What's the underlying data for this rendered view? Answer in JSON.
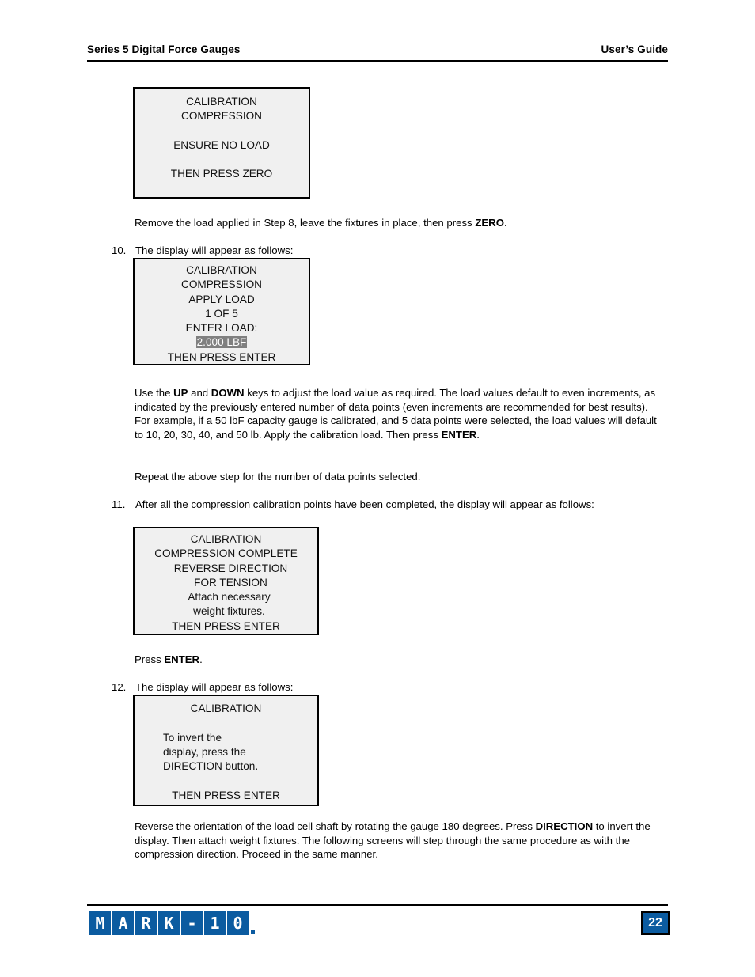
{
  "header": {
    "left_title": "Series 5 Digital Force Gauges",
    "right_title": "User’s Guide"
  },
  "footer": {
    "logo_cells": [
      "M",
      "A",
      "R",
      "K",
      "-",
      "1",
      "0"
    ],
    "page_number": "22",
    "brand_color": "#0b5ba0"
  },
  "content": {
    "box1": {
      "lines": [
        "CALIBRATION",
        "COMPRESSION",
        "",
        "ENSURE NO LOAD",
        "",
        "THEN PRESS ZERO"
      ]
    },
    "para_remove": {
      "text_1": "Remove the load applied in Step 8, leave the fixtures in place, then press ",
      "bold_1": "ZERO",
      "text_2": "."
    },
    "item10": {
      "marker": "10.",
      "text": "The display will appear as follows:"
    },
    "box2": {
      "lines": [
        "CALIBRATION",
        "COMPRESSION",
        "APPLY LOAD",
        "1 OF 5",
        "ENTER LOAD:"
      ],
      "highlighted_value": "2.000 LBF",
      "last_line": "THEN PRESS ENTER"
    },
    "para_updown": {
      "text_1": "Use the ",
      "bold_1": "UP",
      "text_2": " and ",
      "bold_2": "DOWN",
      "text_3": " keys to adjust the load value as required. The load values default to even increments, as indicated by the previously entered number of data points (even increments are recommended for best results). For example, if a 50 lbF capacity gauge is calibrated, and 5 data points were selected, the load values will default to 10, 20, 30, 40, and 50 lb. Apply the calibration load. Then press ",
      "bold_3": "ENTER",
      "text_4": "."
    },
    "para_repeat": {
      "text": "Repeat the above step for the number of data points selected."
    },
    "item11": {
      "marker": "11.",
      "text": "After all the compression calibration points have been completed, the display will appear as follows:"
    },
    "box3": {
      "lines": [
        "CALIBRATION",
        "COMPRESSION COMPLETE",
        "REVERSE DIRECTION",
        "FOR TENSION",
        "Attach necessary",
        "weight fixtures.",
        "THEN PRESS ENTER"
      ]
    },
    "para_press_enter": {
      "text_1": "Press ",
      "bold_1": "ENTER",
      "text_2": "."
    },
    "item12": {
      "marker": "12.",
      "text": "The display will appear as follows:"
    },
    "box4": {
      "title": "CALIBRATION",
      "body_lines": [
        "To invert the",
        "display, press the",
        "DIRECTION button."
      ],
      "last_line": "THEN PRESS ENTER"
    },
    "para_reverse": {
      "text_1": "Reverse the orientation of the load cell shaft by rotating the gauge 180 degrees. Press ",
      "bold_1": "DIRECTION",
      "text_2": " to invert the display. Then attach weight fixtures. The following screens will step through the same procedure as with the compression direction. Proceed in the same manner."
    }
  }
}
